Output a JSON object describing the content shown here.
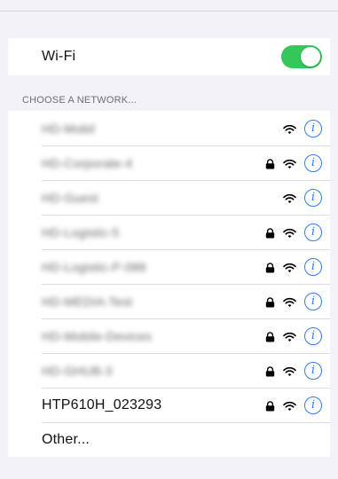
{
  "wifi": {
    "label": "Wi-Fi",
    "enabled": true,
    "toggle_color": "#34c759"
  },
  "section": {
    "header": "CHOOSE A NETWORK..."
  },
  "networks": [
    {
      "name": "HD-Mobil",
      "blurred": true,
      "locked": false,
      "info": "i"
    },
    {
      "name": "HD-Corporate-4",
      "blurred": true,
      "locked": true,
      "info": "i"
    },
    {
      "name": "HD-Guest",
      "blurred": true,
      "locked": false,
      "info": "i"
    },
    {
      "name": "HD-Logistic-5",
      "blurred": true,
      "locked": true,
      "info": "i"
    },
    {
      "name": "HD-Logistic-P-088",
      "blurred": true,
      "locked": true,
      "info": "i"
    },
    {
      "name": "HD-MEDIA-Test",
      "blurred": true,
      "locked": true,
      "info": "i"
    },
    {
      "name": "HD-Mobile-Devices",
      "blurred": true,
      "locked": true,
      "info": "i"
    },
    {
      "name": "HD-GHUB-3",
      "blurred": true,
      "locked": true,
      "info": "i"
    },
    {
      "name": "HTP610H_023293",
      "blurred": false,
      "locked": true,
      "info": "i"
    }
  ],
  "other": {
    "label": "Other..."
  },
  "colors": {
    "accent": "#2f7cf6",
    "background": "#f2f2f7"
  },
  "icons": {
    "lock": "lock-icon",
    "wifi": "wifi-signal-icon",
    "info": "info-icon"
  }
}
